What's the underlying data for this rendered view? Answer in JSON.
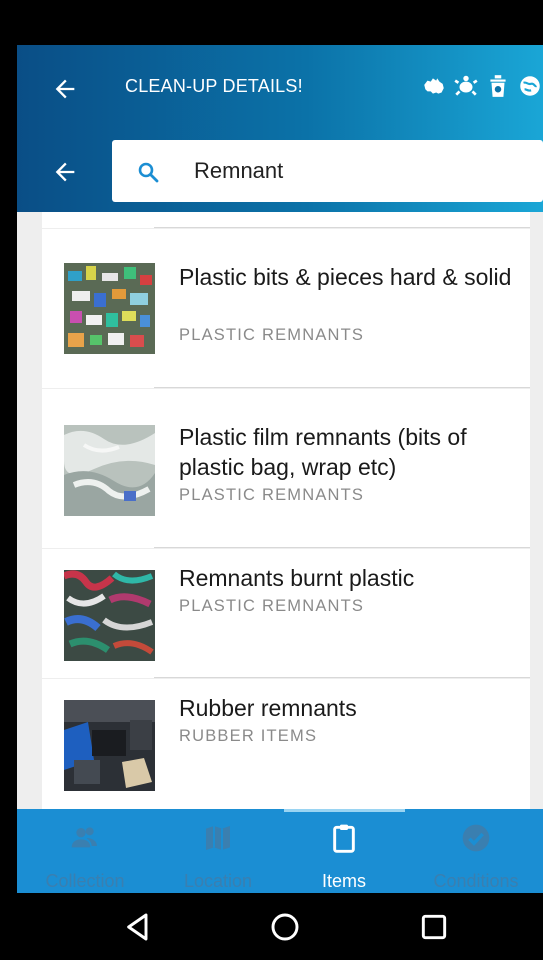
{
  "header": {
    "title": "CLEAN-UP DETAILS!",
    "icons": [
      "australia-icon",
      "turtle-icon",
      "bin-icon",
      "globe-icon"
    ]
  },
  "search": {
    "query": "Remnant"
  },
  "items": [
    {
      "name": "Plastic bits & pieces hard & solid",
      "category": "PLASTIC REMNANTS",
      "thumb": "plastic-bits-photo"
    },
    {
      "name": "Plastic film remnants (bits of plastic bag, wrap etc)",
      "category": "PLASTIC REMNANTS",
      "thumb": "plastic-film-photo"
    },
    {
      "name": "Remnants burnt plastic",
      "category": "PLASTIC REMNANTS",
      "thumb": "burnt-plastic-photo"
    },
    {
      "name": "Rubber remnants",
      "category": "RUBBER ITEMS",
      "thumb": "rubber-photo"
    }
  ],
  "tabs": [
    {
      "label": "Collection",
      "icon": "people-icon",
      "active": false
    },
    {
      "label": "Location",
      "icon": "map-icon",
      "active": false
    },
    {
      "label": "Items",
      "icon": "clipboard-icon",
      "active": true
    },
    {
      "label": "Conditions",
      "icon": "check-circle-icon",
      "active": false
    }
  ],
  "colors": {
    "header_start": "#0a4e86",
    "header_end": "#1aa6d6",
    "tab_bar": "#1b8ed3",
    "search_icon": "#1b8ed3"
  }
}
